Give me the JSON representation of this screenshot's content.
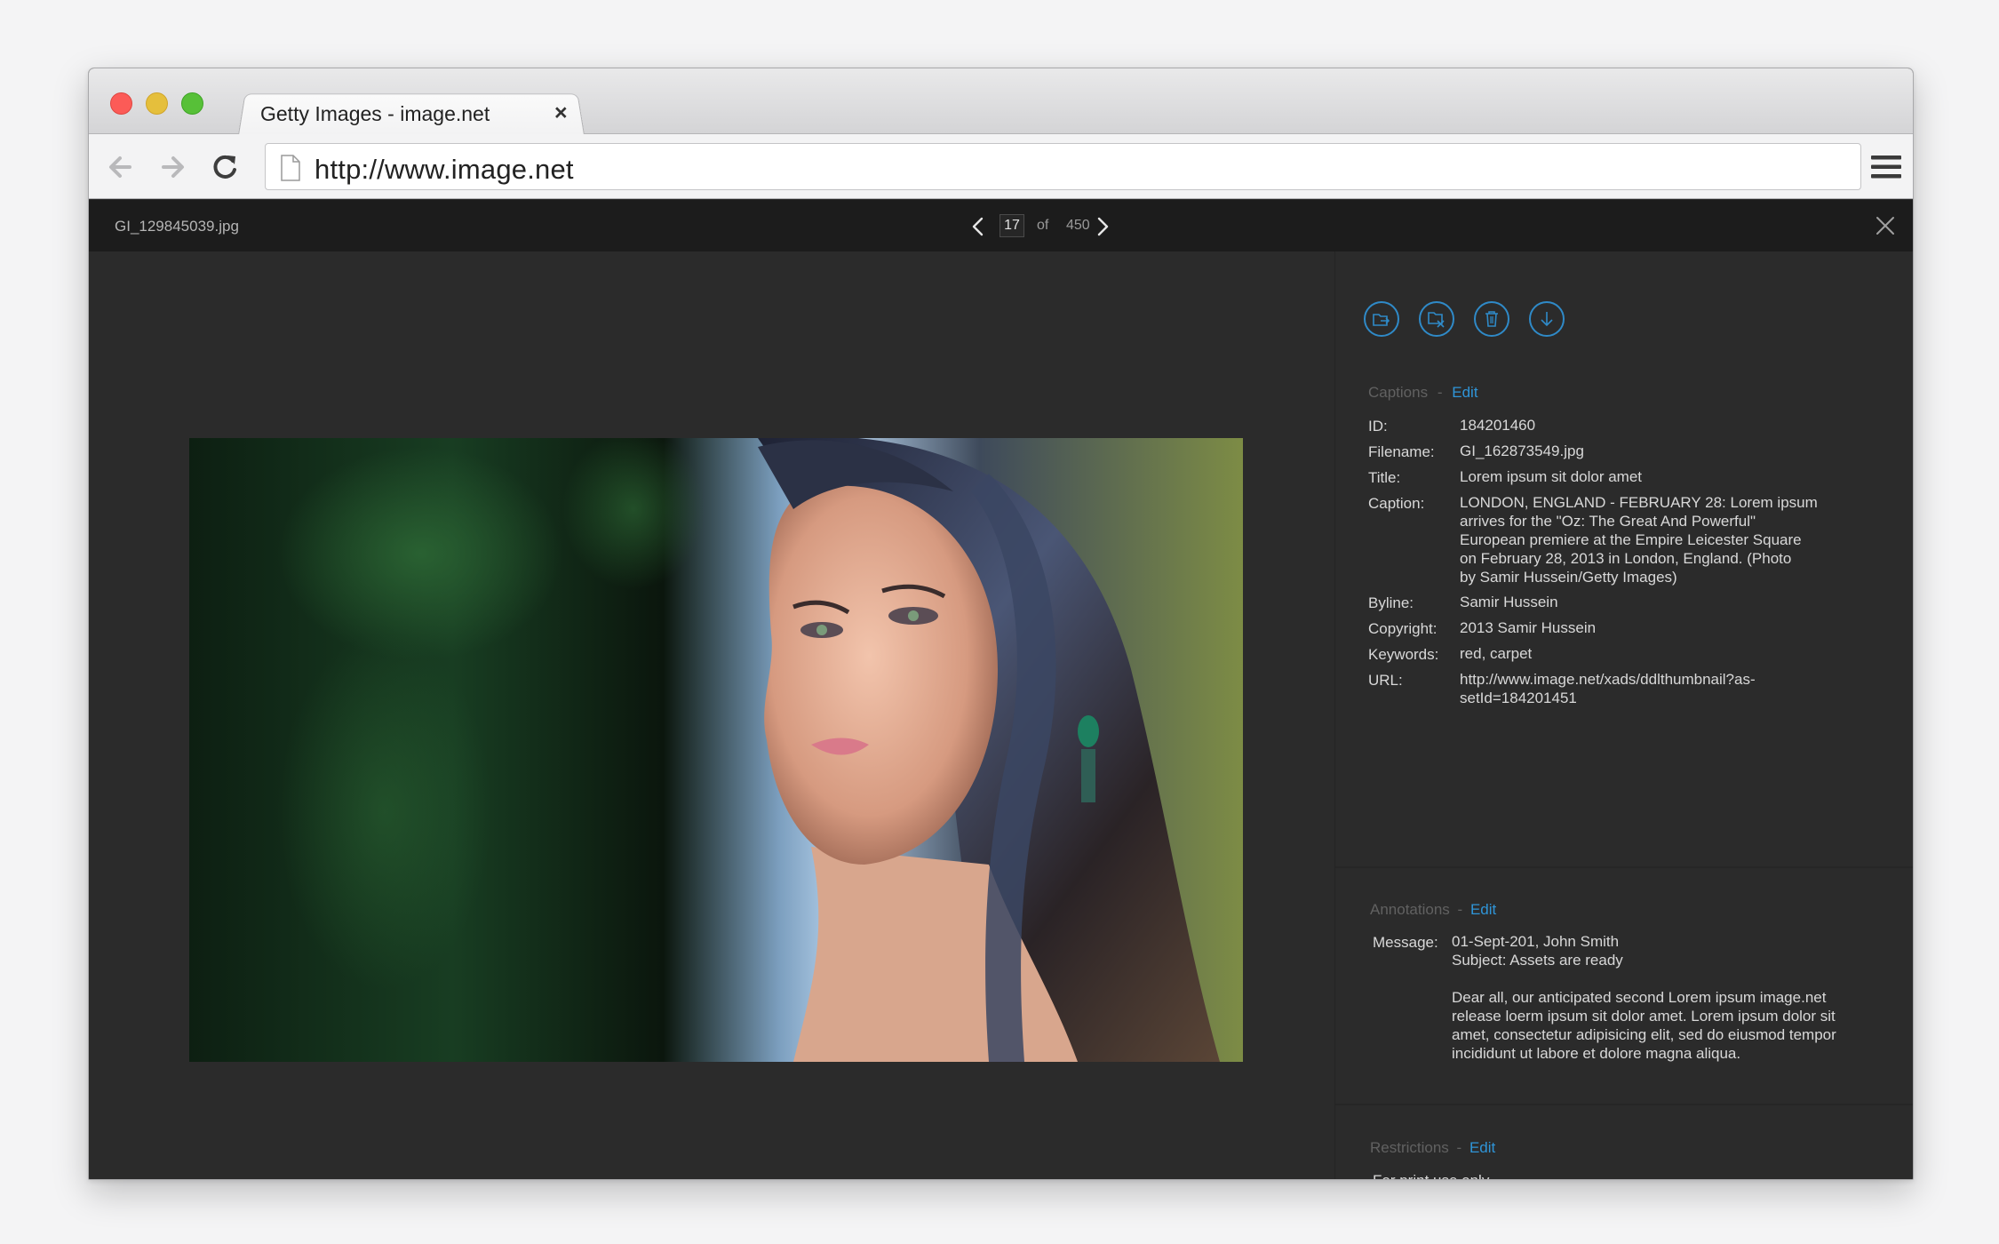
{
  "browser": {
    "tab_title": "Getty Images - image.net",
    "tab_close": "×",
    "url": "http://www.image.net"
  },
  "viewer": {
    "filename": "GI_129845039.jpg",
    "page_current": "17",
    "page_of": "of",
    "page_total": "450"
  },
  "captions": {
    "heading": "Captions",
    "sep": "-",
    "edit": "Edit",
    "fields": [
      {
        "label": "ID:",
        "value": "184201460"
      },
      {
        "label": "Filename:",
        "value": "GI_162873549.jpg"
      },
      {
        "label": "Title:",
        "value": "Lorem ipsum sit dolor amet"
      },
      {
        "label": "Caption:",
        "value": "LONDON, ENGLAND - FEBRUARY 28: Lorem ipsum\narrives for the \"Oz: The Great And Powerful\"\nEuropean premiere at the Empire Leicester Square\non February 28, 2013 in London, England. (Photo\nby Samir Hussein/Getty Images)"
      },
      {
        "label": "Byline:",
        "value": "Samir Hussein"
      },
      {
        "label": "Copyright:",
        "value": "2013 Samir Hussein"
      },
      {
        "label": "Keywords:",
        "value": "red, carpet"
      },
      {
        "label": "URL:",
        "value": "http://www.image.net/xads/ddlthumbnail?as-\nsetId=184201451"
      }
    ]
  },
  "annotations": {
    "heading": "Annotations",
    "sep": "-",
    "edit": "Edit",
    "label": "Message:",
    "date_line": "01-Sept-201, John Smith",
    "subject_line": "Subject: Assets are ready",
    "body": "Dear all, our anticipated second Lorem ipsum image.net\nrelease loerm ipsum sit dolor amet. Lorem ipsum dolor sit\namet, consectetur adipisicing elit, sed do eiusmod tempor\nincididunt ut labore et dolore magna aliqua."
  },
  "restrictions": {
    "heading": "Restrictions",
    "sep": "-",
    "edit": "Edit",
    "text": "For print use only."
  },
  "colors": {
    "accent": "#2f95d8",
    "panel_bg": "#2b2b2b",
    "header_bg": "#1c1c1c"
  },
  "icons": [
    "back-arrow-icon",
    "forward-arrow-icon",
    "reload-icon",
    "document-icon",
    "hamburger-menu-icon",
    "chevron-left-icon",
    "chevron-right-icon",
    "close-icon",
    "move-to-folder-icon",
    "remove-from-folder-icon",
    "trash-icon",
    "download-icon"
  ]
}
